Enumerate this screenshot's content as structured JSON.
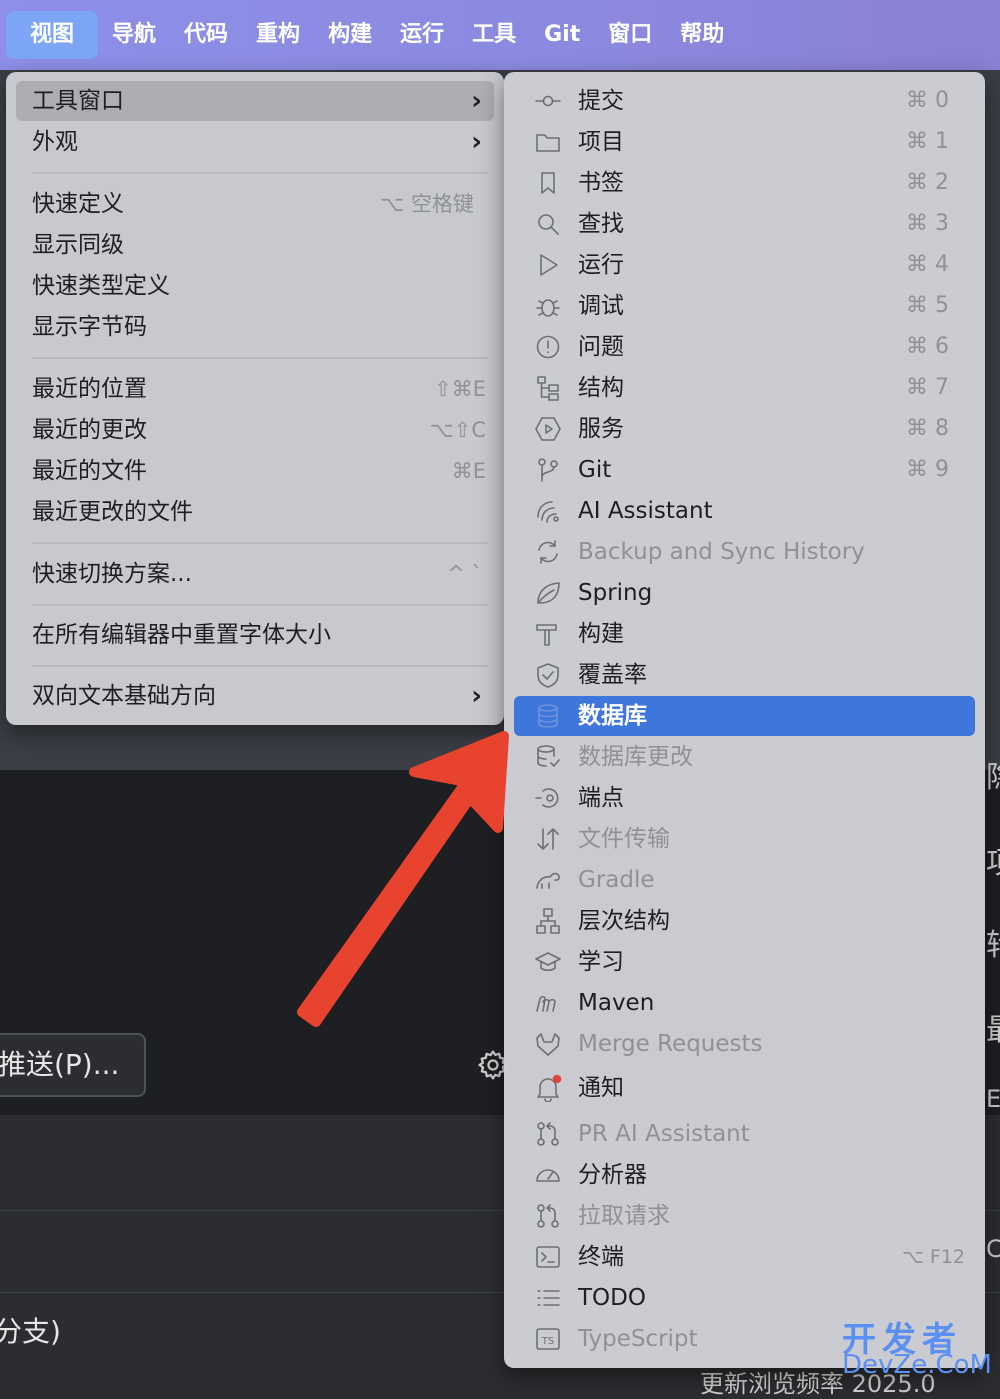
{
  "menubar": [
    "视图",
    "导航",
    "代码",
    "重构",
    "构建",
    "运行",
    "工具",
    "Git",
    "窗口",
    "帮助"
  ],
  "view_menu": {
    "items": [
      {
        "label": "工具窗口",
        "arrow": true,
        "highlight": true
      },
      {
        "label": "外观",
        "arrow": true
      },
      {
        "label": "快速定义",
        "shortcut": "⌥ 空格键"
      },
      {
        "label": "显示同级"
      },
      {
        "label": "快速类型定义"
      },
      {
        "label": "显示字节码"
      },
      {
        "label": "最近的位置",
        "shortcut": "⇧⌘E"
      },
      {
        "label": "最近的更改",
        "shortcut": "⌥⇧C"
      },
      {
        "label": "最近的文件",
        "shortcut": "⌘E"
      },
      {
        "label": "最近更改的文件"
      },
      {
        "label": "快速切换方案...",
        "shortcut": "^ `"
      },
      {
        "label": "在所有编辑器中重置字体大小"
      },
      {
        "label": "双向文本基础方向",
        "arrow": true
      }
    ],
    "arrow_glyph": "›"
  },
  "tool_windows": [
    {
      "label": "提交",
      "icon": "commit-icon",
      "shortcut": "⌘ 0"
    },
    {
      "label": "项目",
      "icon": "folder-icon",
      "shortcut": "⌘ 1"
    },
    {
      "label": "书签",
      "icon": "bookmark-icon",
      "shortcut": "⌘ 2"
    },
    {
      "label": "查找",
      "icon": "search-icon",
      "shortcut": "⌘ 3"
    },
    {
      "label": "运行",
      "icon": "run-icon",
      "shortcut": "⌘ 4"
    },
    {
      "label": "调试",
      "icon": "bug-icon",
      "shortcut": "⌘ 5"
    },
    {
      "label": "问题",
      "icon": "problems-icon",
      "shortcut": "⌘ 6"
    },
    {
      "label": "结构",
      "icon": "structure-icon",
      "shortcut": "⌘ 7"
    },
    {
      "label": "服务",
      "icon": "services-icon",
      "shortcut": "⌘ 8"
    },
    {
      "label": "Git",
      "icon": "git-branch-icon",
      "shortcut": "⌘ 9"
    },
    {
      "label": "AI Assistant",
      "icon": "ai-assistant-icon"
    },
    {
      "label": "Backup and Sync History",
      "icon": "sync-icon",
      "dim": true
    },
    {
      "label": "Spring",
      "icon": "spring-leaf-icon"
    },
    {
      "label": "构建",
      "icon": "hammer-icon"
    },
    {
      "label": "覆盖率",
      "icon": "shield-icon"
    },
    {
      "label": "数据库",
      "icon": "database-icon",
      "selected": true
    },
    {
      "label": "数据库更改",
      "icon": "database-changes-icon",
      "dim": true
    },
    {
      "label": "端点",
      "icon": "endpoints-icon"
    },
    {
      "label": "文件传输",
      "icon": "transfer-icon",
      "dim": true
    },
    {
      "label": "Gradle",
      "icon": "gradle-icon",
      "dim": true
    },
    {
      "label": "层次结构",
      "icon": "hierarchy-icon"
    },
    {
      "label": "学习",
      "icon": "learn-icon"
    },
    {
      "label": "Maven",
      "icon": "maven-icon"
    },
    {
      "label": "Merge Requests",
      "icon": "gitlab-icon",
      "dim": true
    },
    {
      "label": "通知",
      "icon": "bell-icon"
    },
    {
      "label": "PR AI Assistant",
      "icon": "pull-request-icon",
      "dim": true
    },
    {
      "label": "分析器",
      "icon": "profiler-icon"
    },
    {
      "label": "拉取请求",
      "icon": "pull-request-icon",
      "dim": true
    },
    {
      "label": "终端",
      "icon": "terminal-icon",
      "shortcut": "⌥ F12"
    },
    {
      "label": "TODO",
      "icon": "todo-list-icon"
    },
    {
      "label": "TypeScript",
      "icon": "typescript-icon",
      "dim": true
    }
  ],
  "background": {
    "push_button": "推送(P)...",
    "branch_text": "分支)",
    "edge_chars": [
      "隐",
      "项",
      "转",
      "最",
      "E",
      "C"
    ],
    "bottom_text": "更新浏览频率 2025.0"
  },
  "watermark": {
    "line1": "开发者",
    "line2": "DevZe.CoM"
  },
  "colors": {
    "accent": "#3f76db",
    "menubar": "#8b8ae0",
    "annotation_arrow": "#e8432e"
  }
}
